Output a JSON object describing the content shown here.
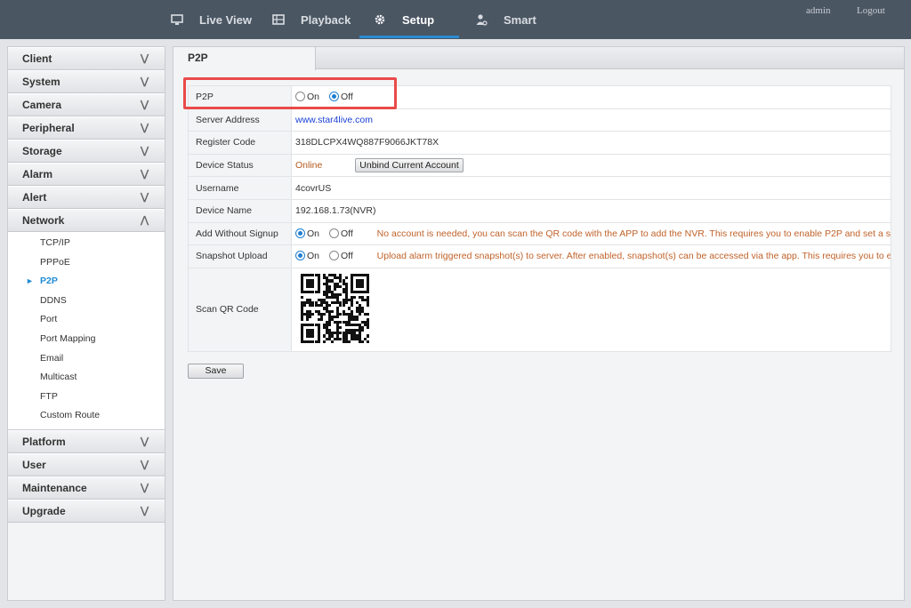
{
  "topnav": {
    "items": [
      {
        "label": "Live View",
        "icon": "monitor-icon"
      },
      {
        "label": "Playback",
        "icon": "film-icon"
      },
      {
        "label": "Setup",
        "icon": "gear-icon"
      },
      {
        "label": "Smart",
        "icon": "smart-person-icon"
      }
    ],
    "active": "Setup",
    "user": "admin",
    "logout": "Logout"
  },
  "sidebar": {
    "groups": [
      {
        "label": "Client"
      },
      {
        "label": "System"
      },
      {
        "label": "Camera"
      },
      {
        "label": "Peripheral"
      },
      {
        "label": "Storage"
      },
      {
        "label": "Alarm"
      },
      {
        "label": "Alert"
      },
      {
        "label": "Network",
        "expanded": true
      },
      {
        "label": "Platform"
      },
      {
        "label": "User"
      },
      {
        "label": "Maintenance"
      },
      {
        "label": "Upgrade"
      }
    ],
    "network_items": [
      "TCP/IP",
      "PPPoE",
      "P2P",
      "DDNS",
      "Port",
      "Port Mapping",
      "Email",
      "Multicast",
      "FTP",
      "Custom Route"
    ],
    "active_item": "P2P"
  },
  "tab": {
    "label": "P2P"
  },
  "form": {
    "p2p": {
      "label": "P2P",
      "on": "On",
      "off": "Off",
      "selected": "Off"
    },
    "server_address": {
      "label": "Server Address",
      "value": "www.star4live.com"
    },
    "register_code": {
      "label": "Register Code",
      "value": "318DLCPX4WQ887F9066JKT78X"
    },
    "device_status": {
      "label": "Device Status",
      "value": "Online",
      "button": "Unbind Current Account"
    },
    "username": {
      "label": "Username",
      "value": "4covrUS"
    },
    "device_name": {
      "label": "Device Name",
      "value": "192.168.1.73(NVR)"
    },
    "add_without_signup": {
      "label": "Add Without Signup",
      "on": "On",
      "off": "Off",
      "selected": "On",
      "hint": "No account is needed, you can scan the QR code with the APP to add the NVR. This requires you to enable P2P and set a strong..."
    },
    "snapshot_upload": {
      "label": "Snapshot Upload",
      "on": "On",
      "off": "Off",
      "selected": "On",
      "hint": "Upload alarm triggered snapshot(s) to server. After enabled, snapshot(s) can be accessed via the app. This requires you to enabl..."
    },
    "scan_qr": {
      "label": "Scan QR Code"
    },
    "save": "Save"
  },
  "colors": {
    "accent": "#1f8bd4",
    "highlight": "#e94a4a",
    "topbar": "#4b5663"
  }
}
